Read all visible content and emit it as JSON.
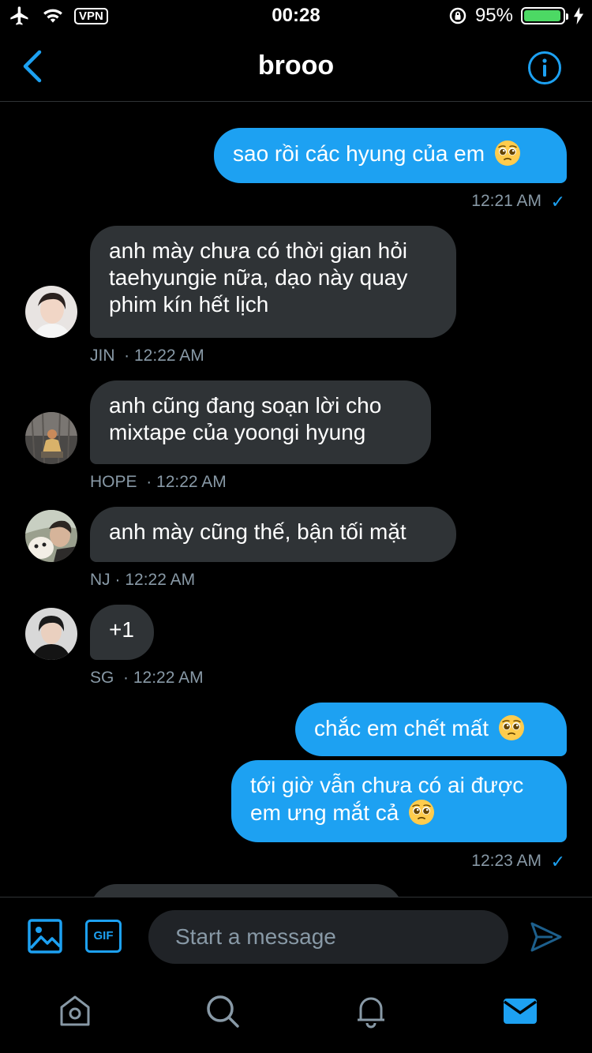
{
  "status_bar": {
    "vpn": "VPN",
    "time": "00:28",
    "battery": "95%",
    "battery_level": 0.95
  },
  "header": {
    "title": "brooo"
  },
  "messages": [
    {
      "text": "sao rồi các hyung của em",
      "emoji": "pleading-face",
      "time": "12:21 AM"
    },
    {
      "text": "anh mày chưa có thời gian hỏi taehyungie nữa, dạo này quay phim kín hết lịch",
      "sender": "JIN",
      "time": "· 12:22 AM"
    },
    {
      "text": "anh cũng đang soạn lời cho mixtape của yoongi hyung",
      "sender": "HOPE",
      "time": "· 12:22 AM"
    },
    {
      "text": "anh mày cũng thế, bận tối mặt",
      "sender": "NJ",
      "time": "· 12:22 AM"
    },
    {
      "text": "+1",
      "sender": "SG",
      "time": "· 12:22 AM"
    },
    {
      "text": "chắc em chết mất",
      "emoji": "pleading-face"
    },
    {
      "text": "tới giờ vẫn chưa có ai được em ưng mắt cả",
      "emoji": "pleading-face",
      "time": "12:23 AM"
    }
  ],
  "composer": {
    "placeholder": "Start a message",
    "gif_label": "GIF"
  },
  "colors": {
    "accent": "#1da1f2",
    "incoming": "#2f3336",
    "meta": "#8899a6",
    "background": "#000000"
  },
  "icons": {
    "back": "chevron-left-icon",
    "info": "info-icon",
    "image": "image-icon",
    "send": "send-icon",
    "home": "home-icon",
    "search": "search-icon",
    "notifications": "bell-icon",
    "messages": "mail-icon"
  }
}
